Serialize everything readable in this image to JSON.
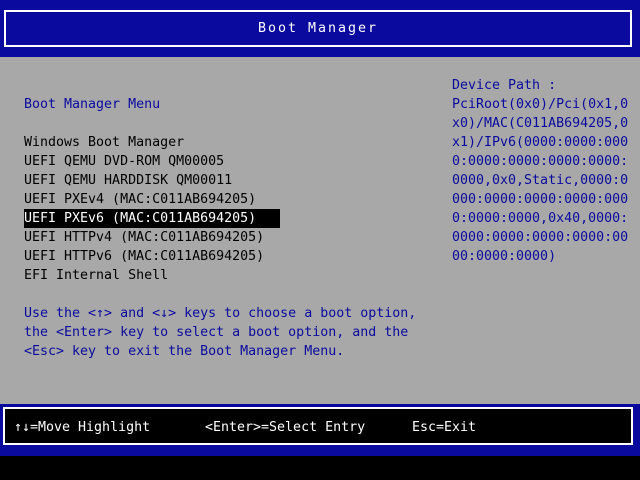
{
  "header": {
    "title": "Boot Manager"
  },
  "menu": {
    "title": "Boot Manager Menu",
    "highlighted_index": 4,
    "items": [
      {
        "label": "Windows Boot Manager"
      },
      {
        "label": "UEFI QEMU DVD-ROM QM00005"
      },
      {
        "label": "UEFI QEMU HARDDISK QM00011"
      },
      {
        "label": "UEFI PXEv4 (MAC:C011AB694205)"
      },
      {
        "label": "UEFI PXEv6 (MAC:C011AB694205)"
      },
      {
        "label": "UEFI HTTPv4 (MAC:C011AB694205)"
      },
      {
        "label": "UEFI HTTPv6 (MAC:C011AB694205)"
      },
      {
        "label": "EFI Internal Shell"
      }
    ]
  },
  "device_path": {
    "label": "Device Path :",
    "lines": [
      "PciRoot(0x0)/Pci(0x1,0",
      "x0)/MAC(C011AB694205,0",
      "x1)/IPv6(0000:0000:000",
      "0:0000:0000:0000:0000:",
      "0000,0x0,Static,0000:0",
      "000:0000:0000:0000:000",
      "0:0000:0000,0x40,0000:",
      "0000:0000:0000:0000:00",
      "00:0000:0000)"
    ]
  },
  "help": {
    "lines": [
      "Use the <↑> and <↓> keys to choose a boot option,",
      "the <Enter> key to select a boot option, and the",
      "<Esc> key to exit the Boot Manager Menu."
    ]
  },
  "footer": {
    "keys": [
      {
        "label": "↑↓=Move Highlight"
      },
      {
        "label": "<Enter>=Select Entry"
      },
      {
        "label": "Esc=Exit"
      }
    ]
  },
  "colors": {
    "blue": "#0a0a9e",
    "light_gray": "#a8a8a8",
    "black": "#000000",
    "white": "#ffffff"
  }
}
